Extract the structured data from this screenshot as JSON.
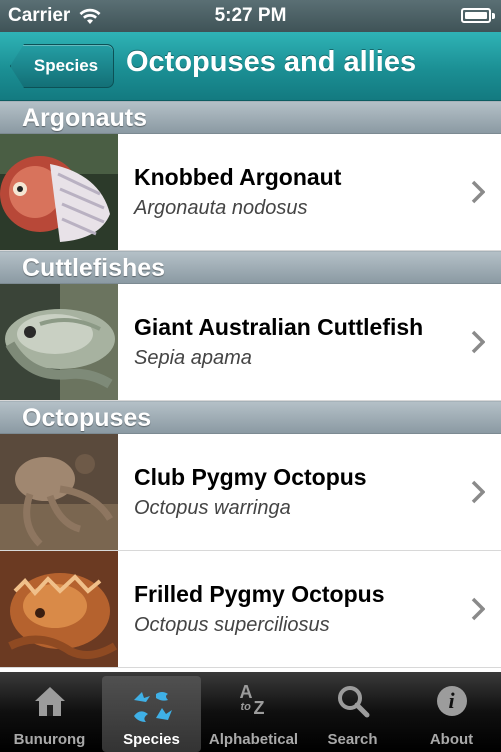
{
  "status_bar": {
    "carrier": "Carrier",
    "time": "5:27 PM"
  },
  "nav": {
    "back_label": "Species",
    "title": "Octopuses and allies"
  },
  "sections": [
    {
      "title": "Argonauts",
      "items": [
        {
          "name": "Knobbed Argonaut",
          "scientific": "Argonauta nodosus"
        }
      ]
    },
    {
      "title": "Cuttlefishes",
      "items": [
        {
          "name": "Giant Australian Cuttlefish",
          "scientific": "Sepia apama"
        }
      ]
    },
    {
      "title": "Octopuses",
      "items": [
        {
          "name": "Club Pygmy Octopus",
          "scientific": "Octopus warringa"
        },
        {
          "name": "Frilled Pygmy Octopus",
          "scientific": "Octopus superciliosus"
        }
      ]
    }
  ],
  "tabs": [
    {
      "label": "Bunurong",
      "icon": "house-icon",
      "active": false
    },
    {
      "label": "Species",
      "icon": "species-icon",
      "active": true
    },
    {
      "label": "Alphabetical",
      "icon": "a-to-z-icon",
      "glyph_top": "A",
      "glyph_mid": "to",
      "glyph_bottom": "Z",
      "active": false
    },
    {
      "label": "Search",
      "icon": "search-icon",
      "active": false
    },
    {
      "label": "About",
      "icon": "info-icon",
      "glyph": "i",
      "active": false
    }
  ],
  "colors": {
    "accent": "#1b8f94",
    "section_header": "#9eabb3",
    "tab_active_label": "#ffffff"
  }
}
